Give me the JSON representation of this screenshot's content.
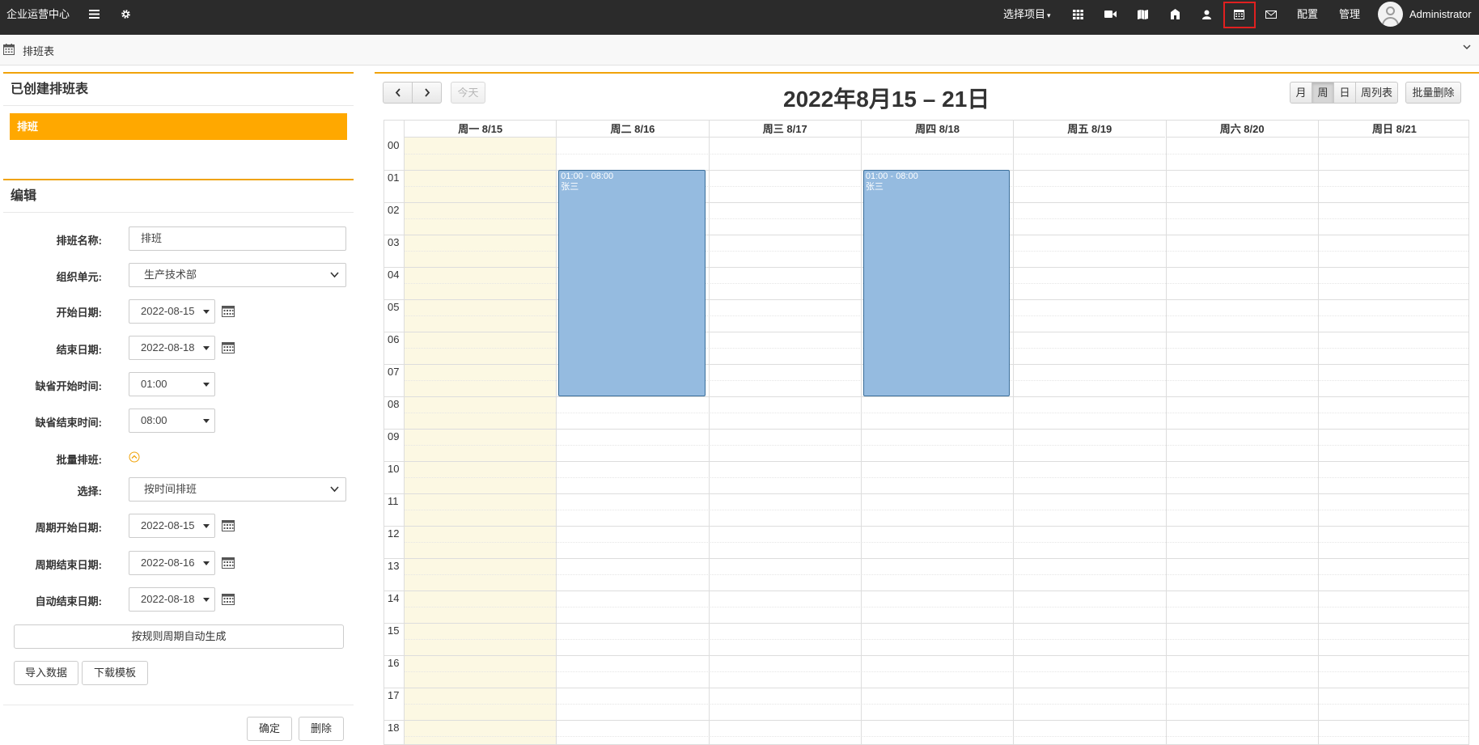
{
  "topbar": {
    "brand": "企业运营中心",
    "project_select": "选择项目",
    "config_label": "配置",
    "manage_label": "管理",
    "user_name": "Administrator"
  },
  "breadcrumb": {
    "title": "排班表"
  },
  "created_panel": {
    "title": "已创建排班表",
    "items": [
      "排班"
    ]
  },
  "edit_panel": {
    "title": "编辑",
    "fields": {
      "name_label": "排班名称:",
      "name_value": "排班",
      "org_label": "组织单元:",
      "org_value": "生产技术部",
      "start_date_label": "开始日期:",
      "start_date_value": "2022-08-15",
      "end_date_label": "结束日期:",
      "end_date_value": "2022-08-18",
      "default_start_label": "缺省开始时间:",
      "default_start_value": "01:00",
      "default_end_label": "缺省结束时间:",
      "default_end_value": "08:00",
      "batch_label": "批量排班:",
      "choose_label": "选择:",
      "choose_value": "按时间排班",
      "period_start_label": "周期开始日期:",
      "period_start_value": "2022-08-15",
      "period_end_label": "周期结束日期:",
      "period_end_value": "2022-08-16",
      "auto_end_label": "自动结束日期:",
      "auto_end_value": "2022-08-18"
    },
    "buttons": {
      "auto_generate": "按规则周期自动生成",
      "import": "导入数据",
      "download_template": "下载模板",
      "confirm": "确定",
      "delete": "删除"
    }
  },
  "calendar": {
    "title": "2022年8月15 – 21日",
    "today_label": "今天",
    "views": {
      "month": "月",
      "week": "周",
      "day": "日",
      "week_list": "周列表"
    },
    "active_view": "周",
    "batch_delete": "批量删除",
    "days": [
      "周一 8/15",
      "周二 8/16",
      "周三 8/17",
      "周四 8/18",
      "周五 8/19",
      "周六 8/20",
      "周日 8/21"
    ],
    "today_index": 0,
    "hours": [
      "00",
      "01",
      "02",
      "03",
      "04",
      "05",
      "06",
      "07",
      "08",
      "09",
      "10",
      "11",
      "12",
      "13",
      "14",
      "15",
      "16",
      "17",
      "18"
    ],
    "events": [
      {
        "day": 1,
        "start": 1,
        "end": 8,
        "time": "01:00 - 08:00",
        "name": "张三"
      },
      {
        "day": 3,
        "start": 1,
        "end": 8,
        "time": "01:00 - 08:00",
        "name": "张三"
      }
    ]
  },
  "colors": {
    "accent": "#f0a30a",
    "selected_item": "#ffa800",
    "event": "#95bbe0",
    "today": "#fcf8e3",
    "topbar": "#2b2b2b"
  }
}
